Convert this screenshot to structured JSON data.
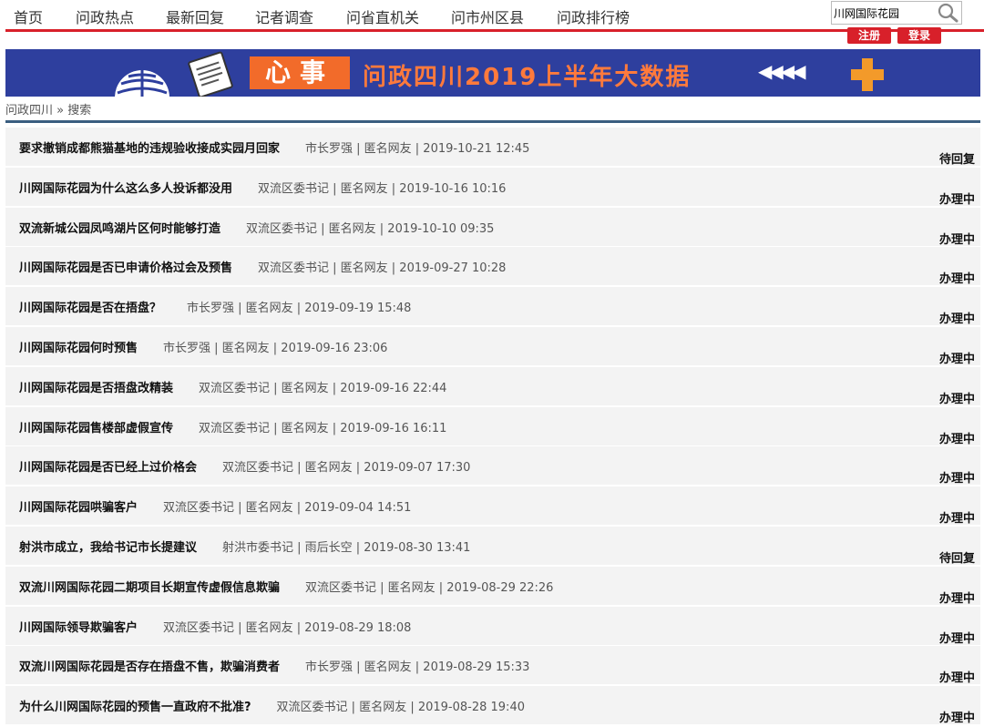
{
  "nav": [
    "首页",
    "问政热点",
    "最新回复",
    "记者调查",
    "问省直机关",
    "问市州区县",
    "问政排行榜"
  ],
  "search": {
    "value": "川网国际花园"
  },
  "auth": {
    "register": "注册",
    "login": "登录"
  },
  "banner": {
    "tag": "心事",
    "title": "问政四川2019上半年大数据",
    "arrows": "◀◀◀◀"
  },
  "breadcrumb": "问政四川 » 搜索",
  "rows": [
    {
      "title": "要求撤销成都熊猫基地的违规验收接成实园月回家",
      "meta": "市长罗强 | 匿名网友 | 2019-10-21 12:45",
      "status": "待回复"
    },
    {
      "title": "川网国际花园为什么这么多人投诉都没用",
      "meta": "双流区委书记 | 匿名网友 | 2019-10-16 10:16",
      "status": "办理中"
    },
    {
      "title": "双流新城公园凤鸣湖片区何时能够打造",
      "meta": "双流区委书记 | 匿名网友 | 2019-10-10 09:35",
      "status": "办理中"
    },
    {
      "title": "川网国际花园是否已申请价格过会及预售",
      "meta": "双流区委书记 | 匿名网友 | 2019-09-27 10:28",
      "status": "办理中"
    },
    {
      "title": "川网国际花园是否在捂盘？",
      "meta": "市长罗强 | 匿名网友 | 2019-09-19 15:48",
      "status": "办理中"
    },
    {
      "title": "川网国际花园何时预售",
      "meta": "市长罗强 | 匿名网友 | 2019-09-16 23:06",
      "status": "办理中"
    },
    {
      "title": "川网国际花园是否捂盘改精装",
      "meta": "双流区委书记 | 匿名网友 | 2019-09-16 22:44",
      "status": "办理中"
    },
    {
      "title": "川网国际花园售楼部虚假宣传",
      "meta": "双流区委书记 | 匿名网友 | 2019-09-16 16:11",
      "status": "办理中"
    },
    {
      "title": "川网国际花园是否已经上过价格会",
      "meta": "双流区委书记 | 匿名网友 | 2019-09-07 17:30",
      "status": "办理中"
    },
    {
      "title": "川网国际花园哄骗客户",
      "meta": "双流区委书记 | 匿名网友 | 2019-09-04 14:51",
      "status": "办理中"
    },
    {
      "title": "射洪市成立，我给书记市长提建议",
      "meta": "射洪市委书记 | 雨后长空 | 2019-08-30 13:41",
      "status": "待回复"
    },
    {
      "title": "双流川网国际花园二期项目长期宣传虚假信息欺骗",
      "meta": "双流区委书记 | 匿名网友 | 2019-08-29 22:26",
      "status": "办理中"
    },
    {
      "title": "川网国际领导欺骗客户",
      "meta": "双流区委书记 | 匿名网友 | 2019-08-29 18:08",
      "status": "办理中"
    },
    {
      "title": "双流川网国际花园是否存在捂盘不售，欺骗消费者",
      "meta": "市长罗强 | 匿名网友 | 2019-08-29 15:33",
      "status": "办理中"
    },
    {
      "title": "为什么川网国际花园的预售一直政府不批准?",
      "meta": "双流区委书记 | 匿名网友 | 2019-08-28 19:40",
      "status": "办理中"
    }
  ]
}
